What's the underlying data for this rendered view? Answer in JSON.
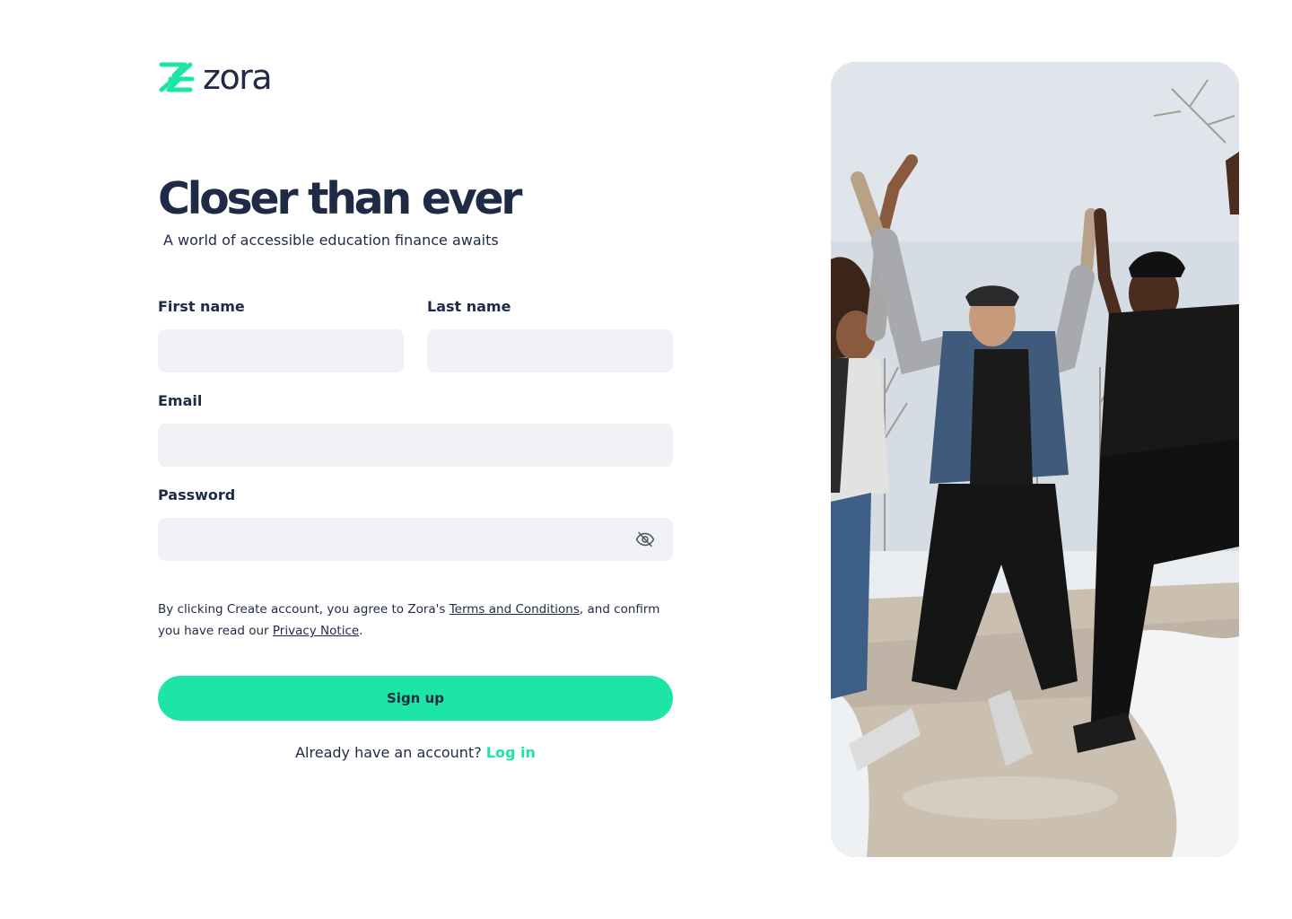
{
  "brand": {
    "name": "zora",
    "logo_icon": "zora-logo-mark",
    "accent_color": "#1de5a6",
    "text_color": "#1f2a44"
  },
  "hero": {
    "title": "Closer than ever",
    "subtitle": "A world of accessible education finance awaits"
  },
  "form": {
    "first_name": {
      "label": "First name",
      "value": "",
      "placeholder": ""
    },
    "last_name": {
      "label": "Last name",
      "value": "",
      "placeholder": ""
    },
    "email": {
      "label": "Email",
      "value": "",
      "placeholder": ""
    },
    "password": {
      "label": "Password",
      "value": "",
      "placeholder": "",
      "toggle_icon": "eye-off-icon"
    },
    "field_background": "#f1f2f5"
  },
  "terms": {
    "prefix": "By clicking Create account, you agree to Zora's ",
    "terms_link": "Terms and Conditions",
    "middle": ", and confirm you have read our ",
    "privacy_link": "Privacy Notice",
    "suffix": "."
  },
  "actions": {
    "signup_label": "Sign up",
    "login_prompt": "Already have an account?",
    "login_link": "Log in"
  },
  "photo": {
    "description_icon": "people-jumping-photo"
  }
}
